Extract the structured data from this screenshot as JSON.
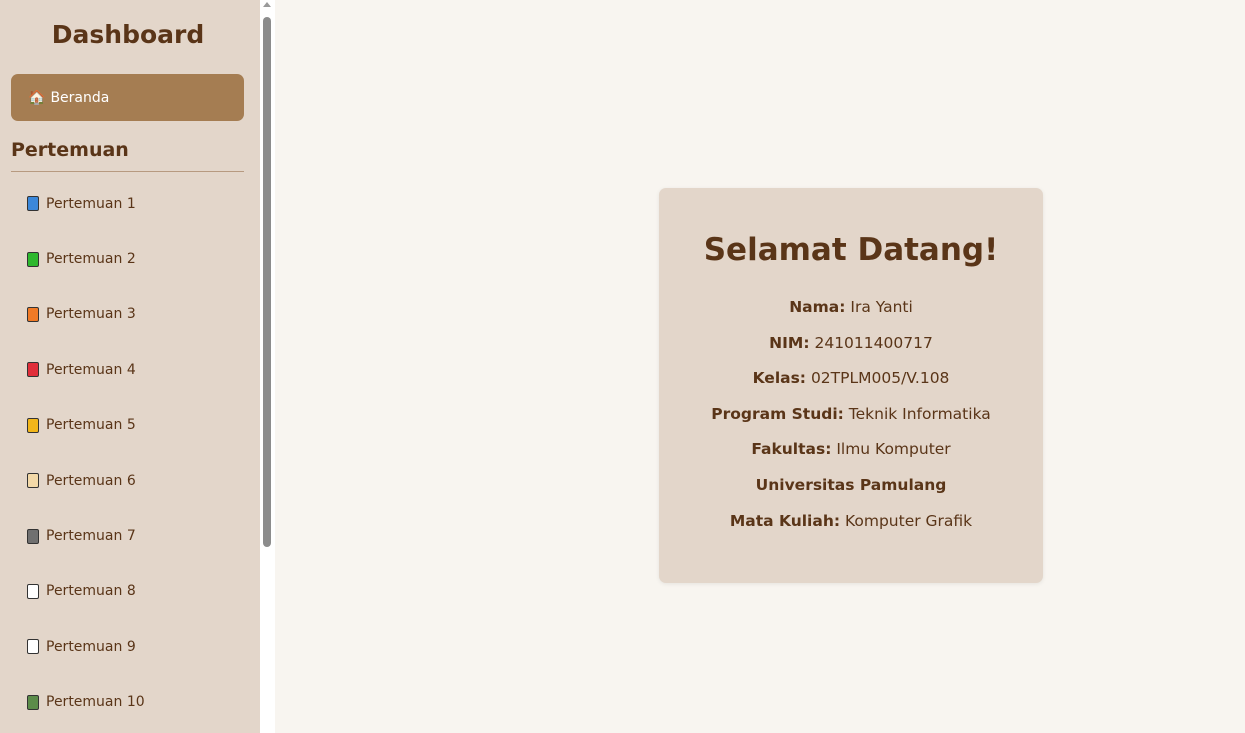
{
  "sidebar": {
    "title": "Dashboard",
    "home": {
      "icon": "house-icon",
      "glyph": "🏠",
      "label": "Beranda"
    },
    "section_title": "Pertemuan",
    "items": [
      {
        "label": "Pertemuan 1",
        "icon": "blue-book-icon",
        "color": "#3b87d9"
      },
      {
        "label": "Pertemuan 2",
        "icon": "green-book-icon",
        "color": "#2eb82e"
      },
      {
        "label": "Pertemuan 3",
        "icon": "orange-book-icon",
        "color": "#f07a26"
      },
      {
        "label": "Pertemuan 4",
        "icon": "red-book-icon",
        "color": "#e02e3a"
      },
      {
        "label": "Pertemuan 5",
        "icon": "yellow-book-icon",
        "color": "#f2b61a"
      },
      {
        "label": "Pertemuan 6",
        "icon": "ledger-icon",
        "color": "#f3d9a8"
      },
      {
        "label": "Pertemuan 7",
        "icon": "notebook-icon",
        "color": "#707070"
      },
      {
        "label": "Pertemuan 8",
        "icon": "page-with-curl-icon",
        "color": "#ffffff"
      },
      {
        "label": "Pertemuan 9",
        "icon": "notebook-blank-icon",
        "color": "#ffffff"
      },
      {
        "label": "Pertemuan 10",
        "icon": "books-icon",
        "color": "#5c8c4a"
      }
    ]
  },
  "card": {
    "heading": "Selamat Datang!",
    "rows": [
      {
        "key": "Nama:",
        "value": " Ira Yanti"
      },
      {
        "key": "NIM:",
        "value": " 241011400717"
      },
      {
        "key": "Kelas:",
        "value": " 02TPLM005/V.108"
      },
      {
        "key": "Program Studi:",
        "value": " Teknik Informatika"
      },
      {
        "key": "Fakultas:",
        "value": " Ilmu Komputer"
      },
      {
        "key": "Universitas Pamulang",
        "value": ""
      },
      {
        "key": "Mata Kuliah:",
        "value": " Komputer Grafik"
      }
    ]
  },
  "colors": {
    "sidebar_bg": "#e3d6ca",
    "accent": "#a57d52",
    "text_brown": "#5a3518",
    "page_bg": "#f8f5f0"
  }
}
